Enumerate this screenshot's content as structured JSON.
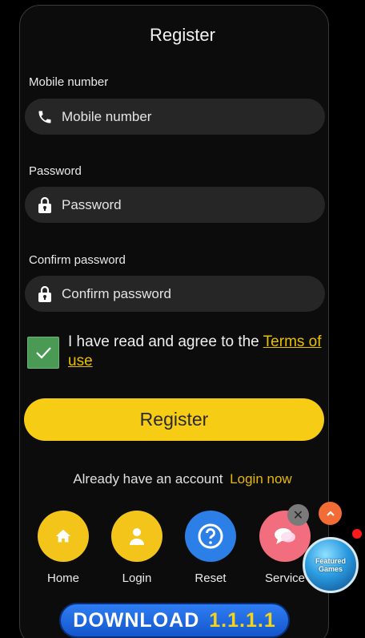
{
  "form": {
    "title": "Register",
    "mobile_label": "Mobile number",
    "mobile_placeholder": "Mobile number",
    "password_label": "Password",
    "password_placeholder": "Password",
    "confirm_label": "Confirm password",
    "confirm_placeholder": "Confirm password",
    "agree_text": "I have read and agree to the ",
    "terms_link": "Terms of use",
    "agree_checked": true,
    "submit_label": "Register"
  },
  "login_prompt": {
    "text": "Already have an account",
    "link": "Login now"
  },
  "shortcuts": [
    {
      "label": "Home",
      "icon": "home-icon",
      "color": "#f3c41a"
    },
    {
      "label": "Login",
      "icon": "user-icon",
      "color": "#f3c41a"
    },
    {
      "label": "Reset",
      "icon": "question-icon",
      "color": "#2c7fe6"
    },
    {
      "label": "Service",
      "icon": "chat-icon",
      "color": "#f26d7d"
    }
  ],
  "floating": {
    "game_badge_text": "Featured Games"
  },
  "download": {
    "label": "DOWNLOAD",
    "version": "1.1.1.1"
  },
  "colors": {
    "accent": "#f6cc15",
    "link": "#e8b800",
    "field_bg": "#262626",
    "check_bg": "#4a9a55"
  }
}
